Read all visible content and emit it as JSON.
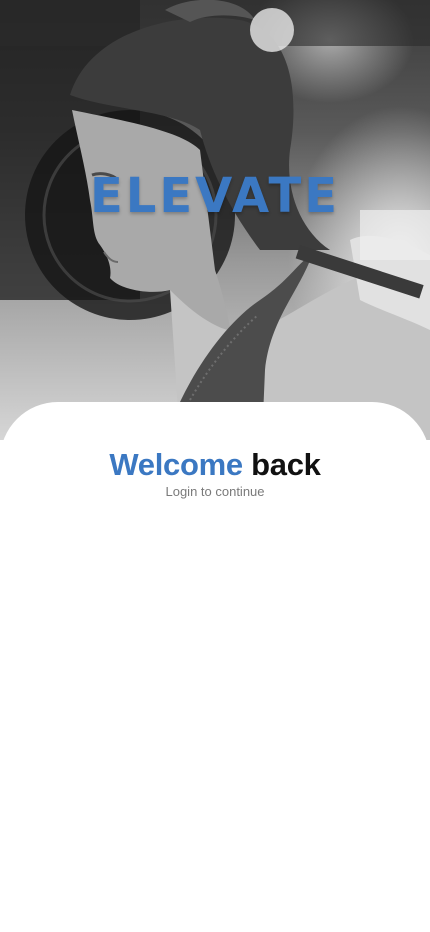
{
  "app": {
    "logo_text": "ELEVATE",
    "brand_color": "#3b78c2"
  },
  "hero": {
    "image_description": "greyscale photo"
  },
  "login": {
    "title_accent": "Welcome",
    "title_rest": "back",
    "subtitle": "Login to continue"
  },
  "colors": {
    "accent": "#3b78c2",
    "title_text": "#111111",
    "subtitle_text": "#7a7a7a",
    "card_background": "#ffffff"
  }
}
